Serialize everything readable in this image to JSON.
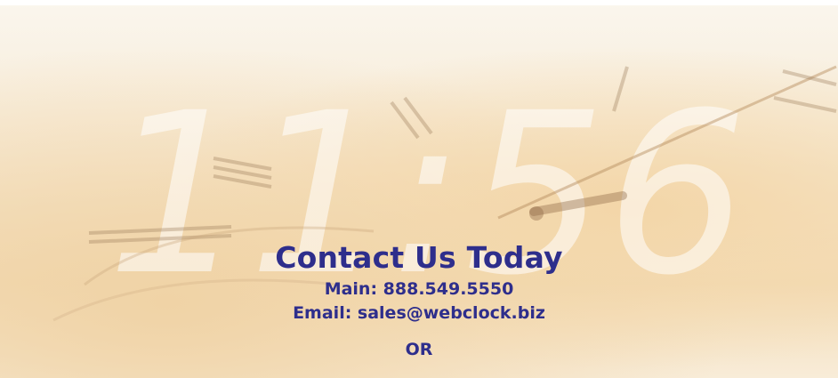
{
  "contact": {
    "heading": "Contact Us Today",
    "main_phone": "Main: 888.549.5550",
    "email": "Email: sales@webclock.biz",
    "or_text": "OR"
  },
  "background": {
    "clock_digits": "11:56",
    "colors": {
      "text": "#2e2e8c",
      "warm_base": "#f7ead4",
      "warm_accent": "#f3d6a8"
    }
  }
}
